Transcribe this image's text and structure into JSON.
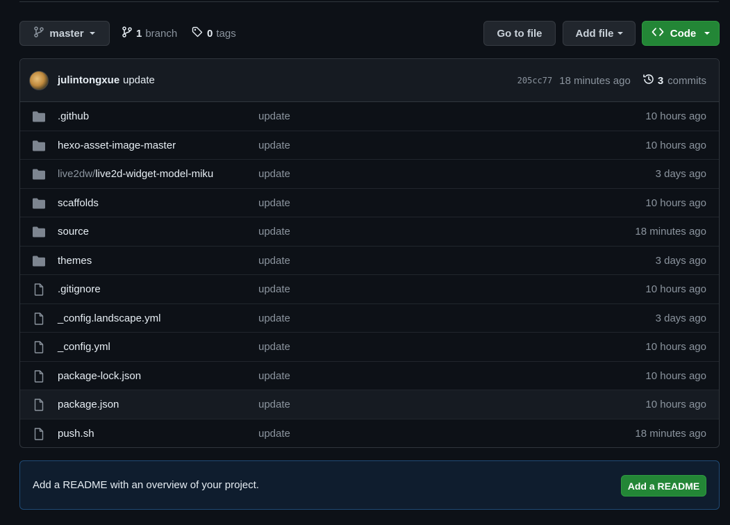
{
  "toolbar": {
    "branch_selector": "master",
    "branch_count": "1",
    "branch_label": "branch",
    "tag_count": "0",
    "tag_label": "tags",
    "goto_file": "Go to file",
    "add_file": "Add file",
    "code": "Code"
  },
  "latest_commit": {
    "author": "julintongxue",
    "message": "update",
    "sha": "205cc77",
    "time": "18 minutes ago",
    "commit_count": "3",
    "commit_label": "commits"
  },
  "files": [
    {
      "type": "folder",
      "prefix": "",
      "name": ".github",
      "message": "update",
      "age": "10 hours ago"
    },
    {
      "type": "folder",
      "prefix": "",
      "name": "hexo-asset-image-master",
      "message": "update",
      "age": "10 hours ago"
    },
    {
      "type": "folder",
      "prefix": "live2dw/",
      "name": "live2d-widget-model-miku",
      "message": "update",
      "age": "3 days ago"
    },
    {
      "type": "folder",
      "prefix": "",
      "name": "scaffolds",
      "message": "update",
      "age": "10 hours ago"
    },
    {
      "type": "folder",
      "prefix": "",
      "name": "source",
      "message": "update",
      "age": "18 minutes ago"
    },
    {
      "type": "folder",
      "prefix": "",
      "name": "themes",
      "message": "update",
      "age": "3 days ago"
    },
    {
      "type": "file",
      "prefix": "",
      "name": ".gitignore",
      "message": "update",
      "age": "10 hours ago"
    },
    {
      "type": "file",
      "prefix": "",
      "name": "_config.landscape.yml",
      "message": "update",
      "age": "3 days ago"
    },
    {
      "type": "file",
      "prefix": "",
      "name": "_config.yml",
      "message": "update",
      "age": "10 hours ago"
    },
    {
      "type": "file",
      "prefix": "",
      "name": "package-lock.json",
      "message": "update",
      "age": "10 hours ago"
    },
    {
      "type": "file",
      "prefix": "",
      "name": "package.json",
      "message": "update",
      "age": "10 hours ago"
    },
    {
      "type": "file",
      "prefix": "",
      "name": "push.sh",
      "message": "update",
      "age": "18 minutes ago"
    }
  ],
  "readme_banner": {
    "text": "Add a README with an overview of your project.",
    "button": "Add a README"
  },
  "colors": {
    "background": "#0d1117",
    "primary_button": "#238636",
    "border": "#30363d",
    "muted_text": "#8b949e"
  }
}
